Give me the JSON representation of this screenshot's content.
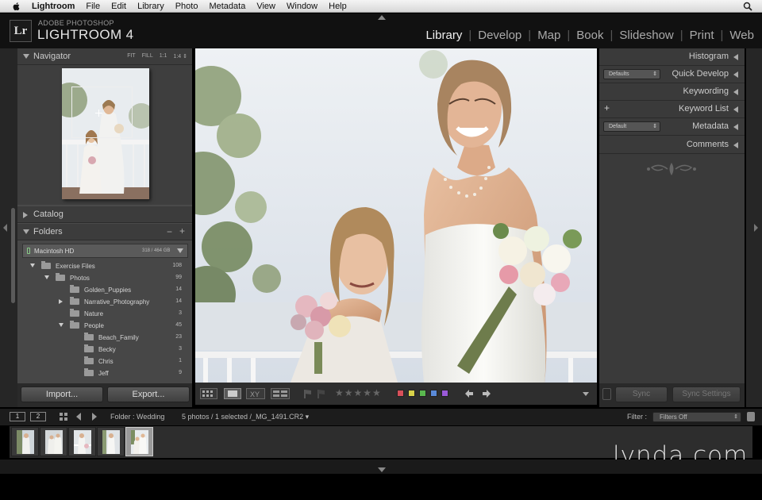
{
  "menubar": {
    "app": "Lightroom",
    "items": [
      "File",
      "Edit",
      "Library",
      "Photo",
      "Metadata",
      "View",
      "Window",
      "Help"
    ]
  },
  "header": {
    "logo": "Lr",
    "brand_small": "ADOBE PHOTOSHOP",
    "brand_big": "LIGHTROOM 4",
    "modules": [
      "Library",
      "Develop",
      "Map",
      "Book",
      "Slideshow",
      "Print",
      "Web"
    ],
    "active_module": "Library"
  },
  "navigator": {
    "title": "Navigator",
    "zooms": [
      "FIT",
      "FILL",
      "1:1",
      "1:4 ⇕"
    ]
  },
  "catalog": {
    "title": "Catalog"
  },
  "folders": {
    "title": "Folders",
    "minus": "−",
    "plus": "+",
    "volume": {
      "name": "Macintosh HD",
      "size": "318 / 464 GB"
    },
    "rows": [
      {
        "name": "Exercise Files",
        "count": "108",
        "depth": 0,
        "expand": "down"
      },
      {
        "name": "Photos",
        "count": "99",
        "depth": 1,
        "expand": "down"
      },
      {
        "name": "Golden_Puppies",
        "count": "14",
        "depth": 2,
        "expand": "none"
      },
      {
        "name": "Narrative_Photography",
        "count": "14",
        "depth": 2,
        "expand": "right"
      },
      {
        "name": "Nature",
        "count": "3",
        "depth": 2,
        "expand": "none"
      },
      {
        "name": "People",
        "count": "45",
        "depth": 2,
        "expand": "down"
      },
      {
        "name": "Beach_Family",
        "count": "23",
        "depth": 3,
        "expand": "none"
      },
      {
        "name": "Becky",
        "count": "3",
        "depth": 3,
        "expand": "none"
      },
      {
        "name": "Chris",
        "count": "1",
        "depth": 3,
        "expand": "none"
      },
      {
        "name": "Jeff",
        "count": "9",
        "depth": 3,
        "expand": "none"
      }
    ]
  },
  "left_buttons": {
    "import": "Import...",
    "export": "Export..."
  },
  "right_panel": {
    "histogram": "Histogram",
    "quick_develop": "Quick Develop",
    "quick_develop_preset": "Defaults",
    "keywording": "Keywording",
    "keyword_list": "Keyword List",
    "keyword_plus": "+",
    "metadata": "Metadata",
    "metadata_preset": "Default",
    "comments": "Comments",
    "sync": "Sync",
    "sync_settings": "Sync Settings"
  },
  "toolbar": {
    "stars": "★★★★★",
    "color_labels": [
      "#d8505a",
      "#d8d24a",
      "#5ab84f",
      "#5a8ad8",
      "#9a5ad8"
    ]
  },
  "filmstrip_bar": {
    "screen1": "1",
    "screen2": "2",
    "source": "Folder : Wedding",
    "info": "5 photos / 1 selected /_MG_1491.CR2 ▾",
    "filter_label": "Filter :",
    "filter_value": "Filters Off"
  },
  "filmstrip": {
    "thumb_count": 5,
    "selected_index": 4
  },
  "watermark": "lynda.com"
}
